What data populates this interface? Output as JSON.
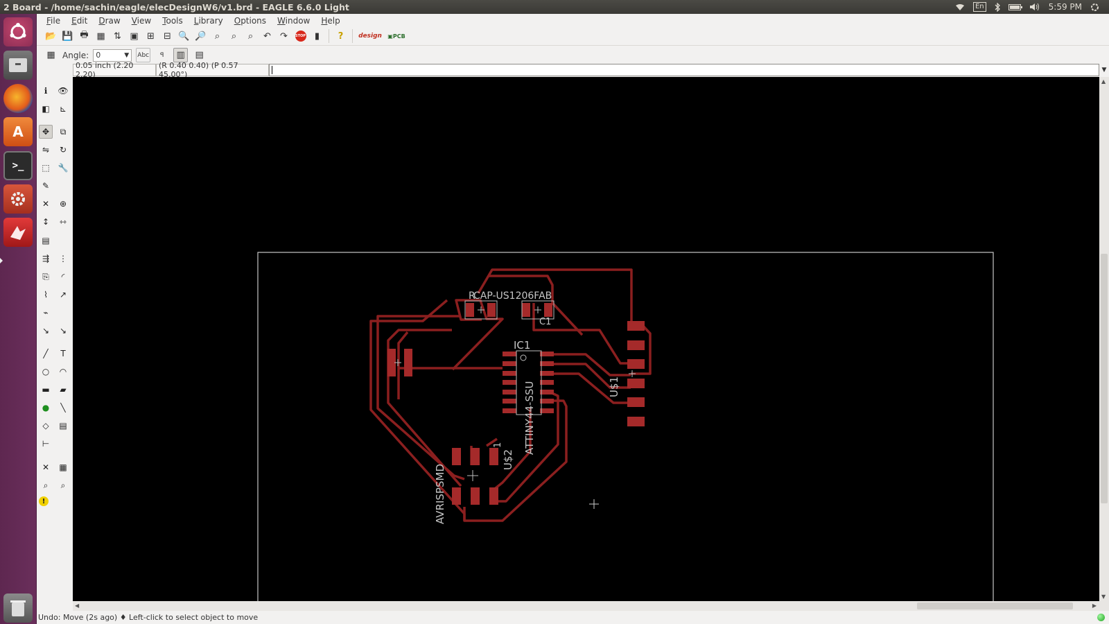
{
  "window": {
    "title": "2 Board - /home/sachin/eagle/elecDesignW6/v1.brd - EAGLE 6.6.0 Light"
  },
  "panel": {
    "keyboard": "En",
    "time": "5:59 PM"
  },
  "menu": [
    "File",
    "Edit",
    "Draw",
    "View",
    "Tools",
    "Library",
    "Options",
    "Window",
    "Help"
  ],
  "params": {
    "angle_label": "Angle:",
    "angle_value": "0"
  },
  "coords": {
    "grid": "0.05 inch (2.20 2.20)",
    "pointer": "(R 0.40 0.40) (P 0.57 45.00°)",
    "command": ""
  },
  "status": {
    "message": "Undo: Move (2s ago)  ♦ Left-click to select object to move"
  },
  "board": {
    "parts": {
      "cap_top": "CAP-US1206FAB",
      "cap_top_partial": "R",
      "c1": "C1",
      "ic1": "IC1",
      "attiny": "ATTINY44-SSU",
      "header_usb": "U$1",
      "avr_header": "AVRISPSMD",
      "u2": "U$2",
      "u2_pin1": "1"
    },
    "trace_color": "#8b1f1f",
    "pad_color": "#a52a2a",
    "outline_color": "#c8c8c8"
  }
}
